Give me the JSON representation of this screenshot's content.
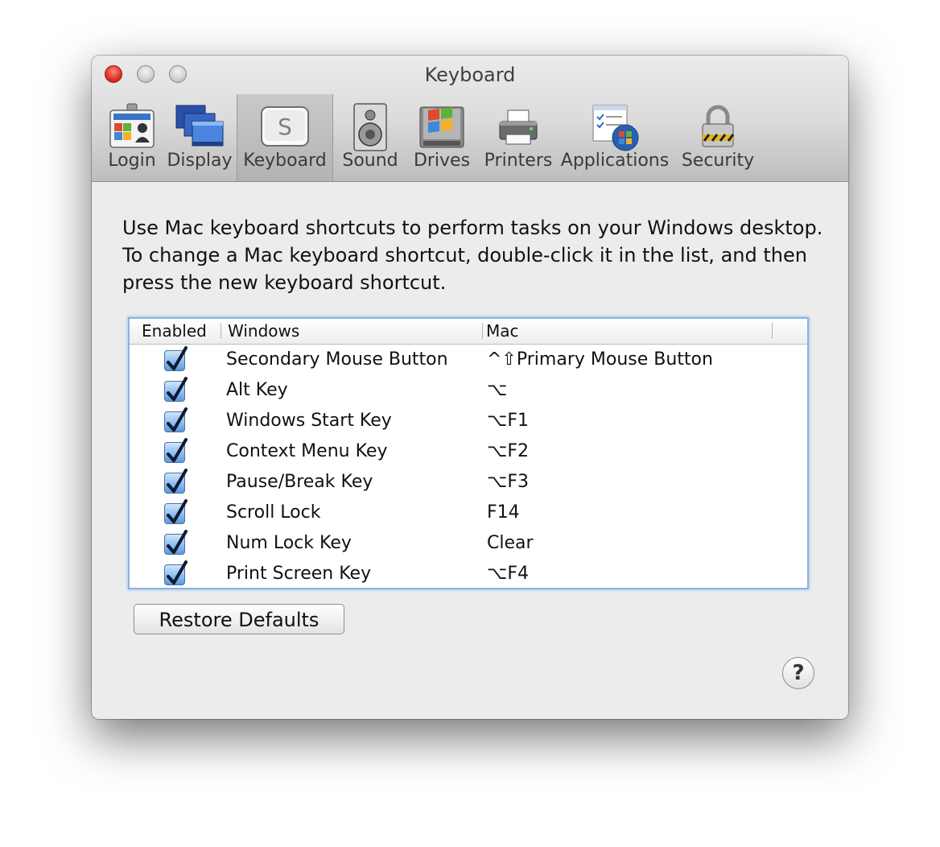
{
  "window": {
    "title": "Keyboard"
  },
  "toolbar": {
    "tabs": [
      {
        "label": "Login",
        "icon": "login-badge-icon"
      },
      {
        "label": "Display",
        "icon": "display-windows-icon"
      },
      {
        "label": "Keyboard",
        "icon": "keyboard-key-icon",
        "key_letter": "S",
        "selected": true
      },
      {
        "label": "Sound",
        "icon": "speaker-icon"
      },
      {
        "label": "Drives",
        "icon": "drive-icon"
      },
      {
        "label": "Printers",
        "icon": "printer-icon"
      },
      {
        "label": "Applications",
        "icon": "applications-icon"
      },
      {
        "label": "Security",
        "icon": "padlock-icon"
      }
    ]
  },
  "description": "Use Mac keyboard shortcuts to perform tasks on your Windows desktop. To change a Mac keyboard shortcut, double-click it in the list, and then press the new keyboard shortcut.",
  "table": {
    "columns": {
      "enabled": "Enabled",
      "windows": "Windows",
      "mac": "Mac"
    },
    "rows": [
      {
        "enabled": true,
        "windows": "Secondary Mouse Button",
        "mac": "^⇧Primary Mouse Button"
      },
      {
        "enabled": true,
        "windows": "Alt Key",
        "mac": "⌥"
      },
      {
        "enabled": true,
        "windows": "Windows Start Key",
        "mac": "⌥F1"
      },
      {
        "enabled": true,
        "windows": "Context Menu Key",
        "mac": "⌥F2"
      },
      {
        "enabled": true,
        "windows": "Pause/Break Key",
        "mac": "⌥F3"
      },
      {
        "enabled": true,
        "windows": "Scroll Lock",
        "mac": "F14"
      },
      {
        "enabled": true,
        "windows": "Num Lock Key",
        "mac": "Clear"
      },
      {
        "enabled": true,
        "windows": "Print Screen Key",
        "mac": "⌥F4"
      }
    ]
  },
  "buttons": {
    "restore_defaults": "Restore Defaults",
    "help": "?"
  },
  "colors": {
    "selection_border": "#8ab3dd",
    "close_button": "#e0342b"
  }
}
